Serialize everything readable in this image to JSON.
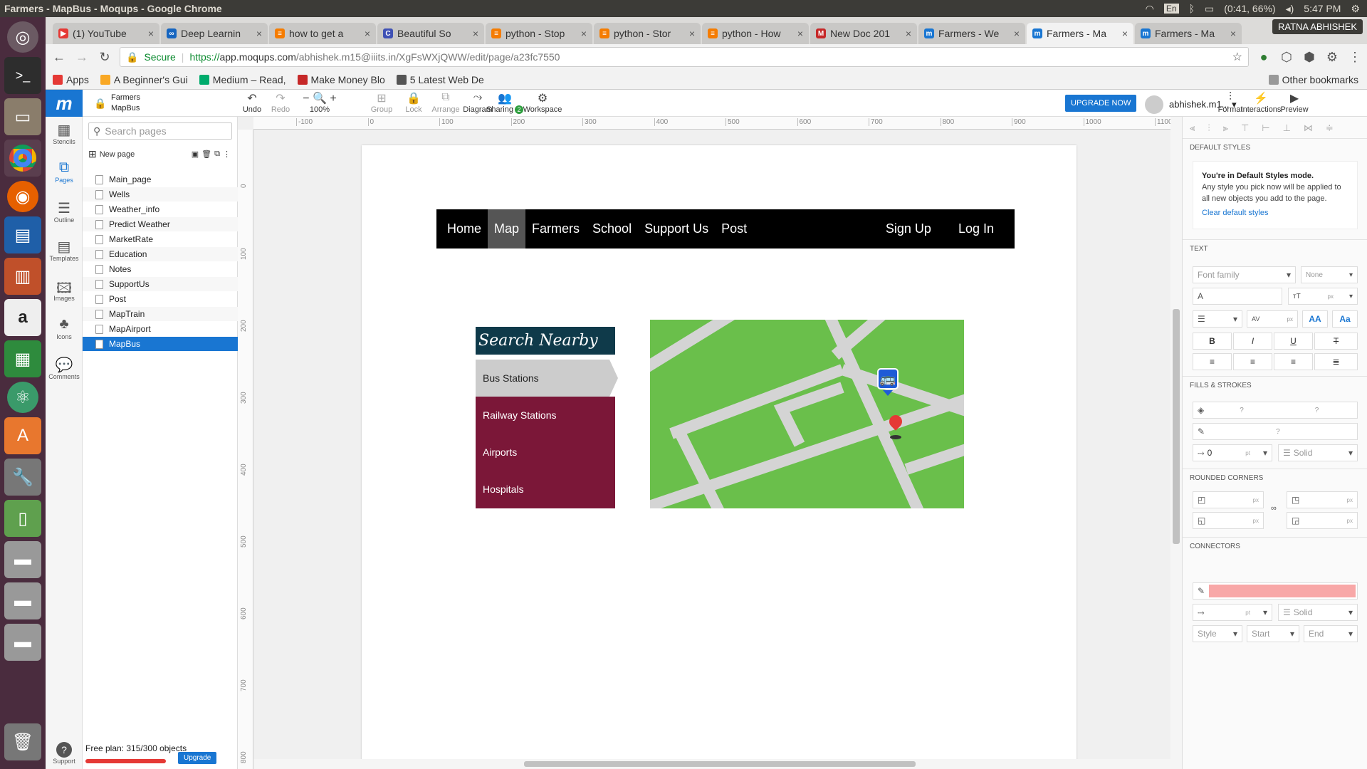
{
  "system": {
    "title": "Farmers - MapBus - Moqups - Google Chrome",
    "lang": "En",
    "battery": "(0:41, 66%)",
    "time": "5:47 PM"
  },
  "tabs": [
    {
      "label": "(1) YouTube",
      "color": "#e53935",
      "glyph": "▶"
    },
    {
      "label": "Deep Learnin",
      "color": "#1565c0",
      "glyph": "∞"
    },
    {
      "label": "how to get a",
      "color": "#f57c00",
      "glyph": "≡"
    },
    {
      "label": "Beautiful So",
      "color": "#3f51b5",
      "glyph": "C"
    },
    {
      "label": "python - Stop",
      "color": "#f57c00",
      "glyph": "≡"
    },
    {
      "label": "python - Stor",
      "color": "#f57c00",
      "glyph": "≡"
    },
    {
      "label": "python - How",
      "color": "#f57c00",
      "glyph": "≡"
    },
    {
      "label": "New Doc 201",
      "color": "#c62828",
      "glyph": "M"
    },
    {
      "label": "Farmers - We",
      "color": "#1976d2",
      "glyph": "m"
    },
    {
      "label": "Farmers - Ma",
      "color": "#1976d2",
      "glyph": "m"
    },
    {
      "label": "Farmers - Ma",
      "color": "#1976d2",
      "glyph": "m"
    }
  ],
  "active_tab": 9,
  "chrome_user": "RATNA ABHISHEK",
  "address": {
    "secure": "Secure",
    "scheme": "https://",
    "host": "app.moqups.com",
    "path": "/abhishek.m15@iiits.in/XgFsWXjQWW/edit/page/a23fc7550"
  },
  "bookmarks": [
    {
      "label": "Apps",
      "color": "#e53935"
    },
    {
      "label": "A Beginner's Gui",
      "color": "#f9a825"
    },
    {
      "label": "Medium – Read, ",
      "color": "#00ab6c"
    },
    {
      "label": "Make Money Blo",
      "color": "#c62828"
    },
    {
      "label": "5 Latest Web De",
      "color": "#555555"
    }
  ],
  "other_bookmarks": "Other bookmarks",
  "moqups": {
    "project": "Farmers",
    "page": "MapBus",
    "tools": [
      {
        "label": "Undo",
        "icon": "↶",
        "dis": false
      },
      {
        "label": "Redo",
        "icon": "↷",
        "dis": true
      },
      {
        "label": "100%",
        "icon": "− 🔍 +",
        "dis": false
      },
      {
        "label": "Group",
        "icon": "⊞",
        "dis": true
      },
      {
        "label": "Lock",
        "icon": "🔒",
        "dis": true
      },
      {
        "label": "Arrange",
        "icon": "⧉",
        "dis": true
      },
      {
        "label": "Diagram",
        "icon": "⤳",
        "dis": false
      },
      {
        "label": "Sharing",
        "icon": "👥",
        "dis": false
      },
      {
        "label": "Workspace",
        "icon": "⚙",
        "dis": false
      }
    ],
    "sharing_count": "2",
    "upgrade_now": "UPGRADE NOW",
    "user": "abhishek.m1...",
    "right_tools": [
      {
        "label": "Format",
        "icon": "⫶"
      },
      {
        "label": "Interactions",
        "icon": "⚡"
      },
      {
        "label": "Preview",
        "icon": "▶"
      }
    ]
  },
  "rail": [
    {
      "label": "Stencils",
      "icon": "▦"
    },
    {
      "label": "Pages",
      "icon": "⧉"
    },
    {
      "label": "Outline",
      "icon": "☰"
    },
    {
      "label": "Templates",
      "icon": "▤"
    },
    {
      "label": "Images",
      "icon": "🖾"
    },
    {
      "label": "Icons",
      "icon": "♣"
    },
    {
      "label": "Comments",
      "icon": "💬"
    }
  ],
  "support": "Support",
  "pages_panel": {
    "search_placeholder": "Search pages",
    "new_page": "New page",
    "pages": [
      "Main_page",
      "Wells",
      "Weather_info",
      "Predict Weather",
      "MarketRate",
      "Education",
      "Notes",
      "SupportUs",
      "Post",
      "MapTrain",
      "MapAirport",
      "MapBus"
    ],
    "active_page": "MapBus",
    "plan": "Free plan: 315/300 objects",
    "upgrade": "Upgrade"
  },
  "ruler_h": [
    "-100",
    "0",
    "100",
    "200",
    "300",
    "400",
    "500",
    "600",
    "700",
    "800",
    "900",
    "1000",
    "1100"
  ],
  "ruler_v": [
    "0",
    "100",
    "200",
    "300",
    "400",
    "500",
    "600",
    "700",
    "800"
  ],
  "mockup": {
    "nav": [
      "Home",
      "Map",
      "Farmers",
      "School",
      "Support Us",
      "Post"
    ],
    "nav_selected": "Map",
    "nav_right": [
      "Sign Up",
      "Log In"
    ],
    "search_title": "Search Nearby",
    "active_item": "Bus Stations",
    "items": [
      "Railway Stations",
      "Airports",
      "Hospitals"
    ]
  },
  "right_panel": {
    "default_styles": "DEFAULT STYLES",
    "ds_title": "You're in Default Styles mode.",
    "ds_text": "Any style you pick now will be applied to all new objects you add to the page.",
    "ds_link": "Clear default styles",
    "text": "TEXT",
    "font_family": "Font family",
    "none": "None",
    "px": "px",
    "pt": "pt",
    "fills": "FILLS & STROKES",
    "q": "?",
    "stroke_w": "0",
    "solid": "Solid",
    "rounded": "ROUNDED CORNERS",
    "connectors": "CONNECTORS",
    "style": "Style",
    "start": "Start",
    "end": "End",
    "aa1": "AA",
    "aa2": "Aa"
  }
}
